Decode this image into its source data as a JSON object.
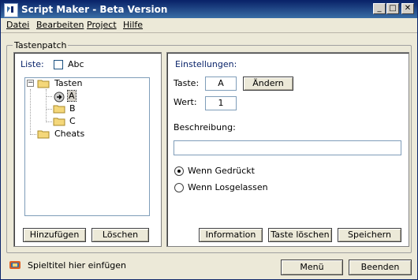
{
  "window": {
    "title": "Script Maker - Beta Version"
  },
  "menu": {
    "items": [
      "Datei",
      "Bearbeiten",
      "Project",
      "Hilfe"
    ]
  },
  "group": {
    "label": "Tastenpatch"
  },
  "left": {
    "liste_label": "Liste:",
    "checkbox_label": "Abc",
    "tree": {
      "root": "Tasten",
      "children": [
        "A",
        "B",
        "C"
      ],
      "other": "Cheats"
    },
    "buttons": {
      "add": "Hinzufügen",
      "delete": "Löschen"
    }
  },
  "right": {
    "heading": "Einstellungen:",
    "taste_label": "Taste:",
    "taste_value": "A",
    "change_button": "Ändern",
    "wert_label": "Wert:",
    "wert_value": "1",
    "beschreibung_label": "Beschreibung:",
    "beschreibung_value": "",
    "radio_pressed": "Wenn Gedrückt",
    "radio_released": "Wenn Losgelassen",
    "buttons": {
      "info": "Information",
      "delete_key": "Taste löschen",
      "save": "Speichern"
    }
  },
  "footer": {
    "status_text": "Spieltitel hier einfügen",
    "menu_button": "Menü",
    "exit_button": "Beenden"
  }
}
